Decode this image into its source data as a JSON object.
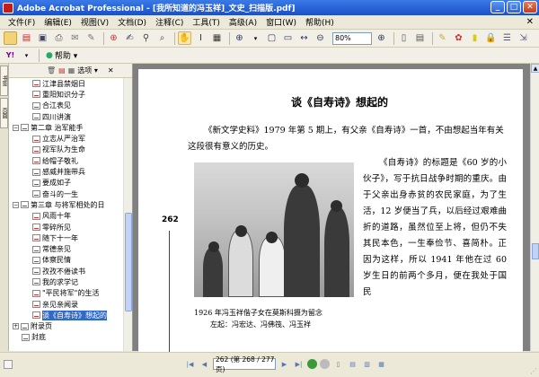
{
  "window": {
    "title": "Adobe Acrobat Professional - [我所知道的冯玉祥]_文史_扫描版.pdf]",
    "minimize": "_",
    "maximize": "□",
    "close": "✕"
  },
  "menu": {
    "items": [
      "文件(F)",
      "编辑(E)",
      "视图(V)",
      "文档(D)",
      "注释(C)",
      "工具(T)",
      "高级(A)",
      "窗口(W)",
      "帮助(H)"
    ],
    "doc_close": "✕"
  },
  "toolbar": {
    "zoom_value": "80%",
    "help_label": "帮助 ▾"
  },
  "nav_tabs": [
    "书签",
    "页面"
  ],
  "bookmarks_panel": {
    "options_label": "选项 ▾",
    "items": [
      {
        "label": "江津县禁烟日",
        "level": 2,
        "expander": ""
      },
      {
        "label": "重阳知识分子",
        "level": 2,
        "expander": ""
      },
      {
        "label": "合江表见",
        "level": 2,
        "expander": ""
      },
      {
        "label": "四川讲演",
        "level": 2,
        "expander": ""
      },
      {
        "label": "第二章 治军能手",
        "level": 1,
        "expander": "−"
      },
      {
        "label": "立志从严治军",
        "level": 2,
        "expander": ""
      },
      {
        "label": "视军队为生命",
        "level": 2,
        "expander": ""
      },
      {
        "label": "给帽子敬礼",
        "level": 2,
        "expander": ""
      },
      {
        "label": "感威并施带兵",
        "level": 2,
        "expander": ""
      },
      {
        "label": "要成如子",
        "level": 2,
        "expander": ""
      },
      {
        "label": "奋斗的一生",
        "level": 2,
        "expander": ""
      },
      {
        "label": "第三章 与将军相处的日",
        "level": 1,
        "expander": "−"
      },
      {
        "label": "风雨十年",
        "level": 2,
        "expander": ""
      },
      {
        "label": "零碎所见",
        "level": 2,
        "expander": ""
      },
      {
        "label": "随下十一年",
        "level": 2,
        "expander": ""
      },
      {
        "label": "常德亲见",
        "level": 2,
        "expander": ""
      },
      {
        "label": "体察民情",
        "level": 2,
        "expander": ""
      },
      {
        "label": "孜孜不倦读书",
        "level": 2,
        "expander": ""
      },
      {
        "label": "我的求学记",
        "level": 2,
        "expander": ""
      },
      {
        "label": "\"平民将军\"的生活",
        "level": 2,
        "expander": ""
      },
      {
        "label": "亲见亲闻录",
        "level": 2,
        "expander": ""
      },
      {
        "label": "谈《自寿诗》想起的",
        "level": 2,
        "expander": "",
        "selected": true
      },
      {
        "label": "附录页",
        "level": 1,
        "expander": "+"
      },
      {
        "label": "封底",
        "level": 1,
        "expander": ""
      }
    ]
  },
  "document": {
    "heading": "谈《自寿诗》想起的",
    "paragraph1": "《新文学史料》1979 年第 5 期上，有父亲《自寿诗》一首，不由想起当年有关这段很有意义的历史。",
    "paragraph2": "《自寿诗》的标题是《60 岁的小伙子》，写于抗日战争时期的重庆。由于父亲出身赤贫的农民家庭，为了生活，12 岁便当了兵，以后经过艰难曲折的道路，虽然位至上将，但仍不失其民本色，一生奉俭节、喜简朴。正因为这样，所以 1941 年他在过 60 岁生日的前两个多月，便在我处于国民",
    "caption_line1": "1926 年冯玉祥偕子女在莫斯科摄为留念",
    "caption_line2": "左起：冯宏达、冯佛筏、冯玉祥",
    "page_number": "262"
  },
  "statusbar": {
    "page_box": "262 (第 268 / 277 页)"
  }
}
